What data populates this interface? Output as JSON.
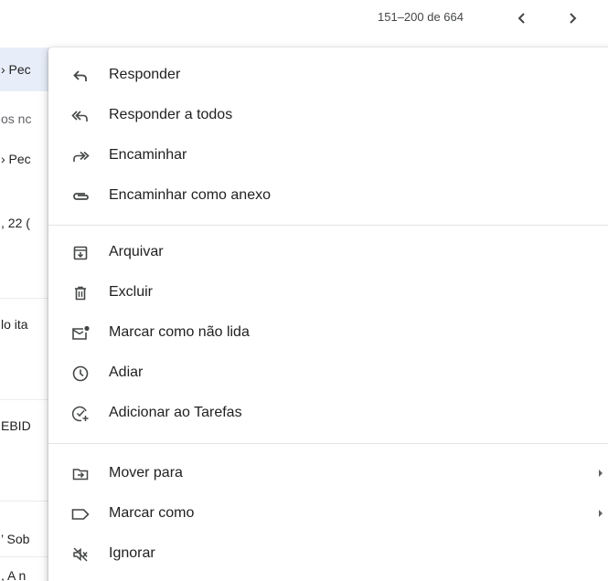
{
  "pager": {
    "count_text": "151–200 de 664"
  },
  "background_list": {
    "fragments": [
      "› Pec",
      "os nc",
      "› Pec",
      ", 22 (",
      "lo ita",
      "EBID",
      "’ Sob",
      ", A n"
    ]
  },
  "menu": {
    "reply": "Responder",
    "reply_all": "Responder a todos",
    "forward": "Encaminhar",
    "forward_attachment": "Encaminhar como anexo",
    "archive": "Arquivar",
    "delete": "Excluir",
    "mark_unread": "Marcar como não lida",
    "snooze": "Adiar",
    "add_tasks": "Adicionar ao Tarefas",
    "move_to": "Mover para",
    "label_as": "Marcar como",
    "mute": "Ignorar"
  },
  "colors": {
    "icon": "#444746",
    "text": "#1f1f1f",
    "selected_row": "#e8eef9"
  }
}
